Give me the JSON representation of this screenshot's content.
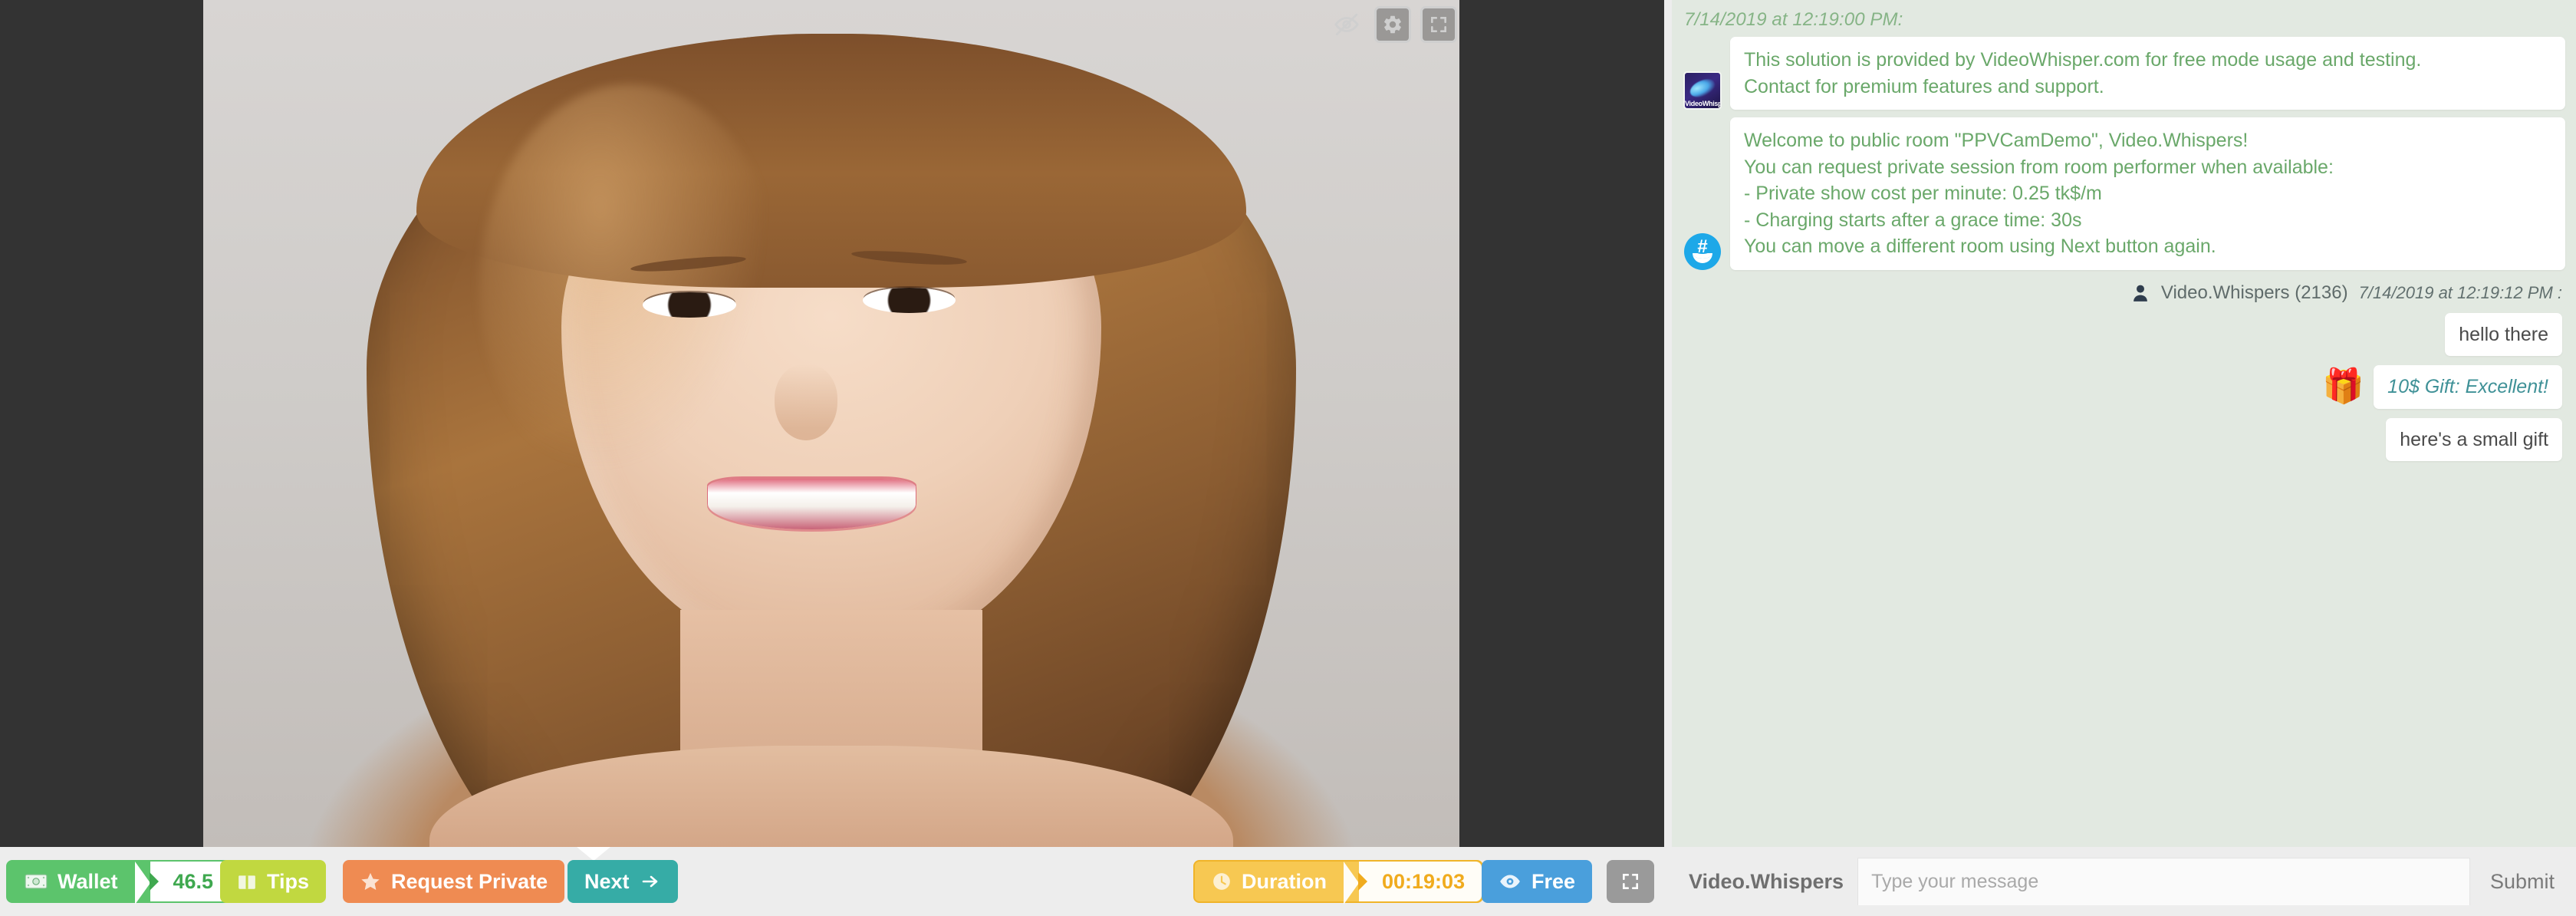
{
  "video": {
    "controls": [
      {
        "name": "hide-video-icon",
        "label": "eye-slash-icon",
        "boxed": false
      },
      {
        "name": "settings-icon",
        "label": "gear-icon",
        "boxed": true
      },
      {
        "name": "fullscreen-icon",
        "label": "expand-icon",
        "boxed": true
      }
    ]
  },
  "toolbar": {
    "wallet": {
      "label": "Wallet",
      "value": "46.5",
      "icon": "money-icon",
      "color": "#5cc46c"
    },
    "tips": {
      "label": "Tips",
      "icon": "gift-box-icon",
      "color": "#c1d840"
    },
    "request_private": {
      "label": "Request Private",
      "icon": "star-icon",
      "color": "#ef8b52"
    },
    "next": {
      "label": "Next",
      "icon": "arrow-right-icon",
      "color": "#36aca6"
    },
    "duration": {
      "label": "Duration",
      "value": "00:19:03",
      "icon": "clock-icon",
      "color": "#f7c852"
    },
    "mode": {
      "label": "Free",
      "icon": "eye-icon",
      "color": "#4a9fdc"
    },
    "fullscreen": {
      "label": "",
      "icon": "expand-icon",
      "color": "#9a9a9a"
    }
  },
  "chat": {
    "timestamp": "7/14/2019 at 12:19:00 PM:",
    "system_messages": [
      {
        "avatar": "videowhisper-logo",
        "avatar_text": "VideoWhisper",
        "lines": [
          "This solution is provided by VideoWhisper.com for free mode usage and testing.",
          "Contact for premium features and support."
        ]
      },
      {
        "avatar": "hash-smile-icon",
        "avatar_text": "#",
        "lines": [
          "Welcome to public room \"PPVCamDemo\", Video.Whispers!",
          "You can request private session from room performer when available:",
          "- Private show cost per minute: 0.25 tk$/m",
          "- Charging starts after a grace time: 30s",
          "You can move a different room using Next button again."
        ]
      }
    ],
    "user_header": {
      "icon": "person-icon",
      "username": "Video.Whispers (2136)",
      "timestamp": "7/14/2019 at 12:19:12 PM :"
    },
    "user_messages": [
      {
        "text": "hello there",
        "type": "text",
        "icon": ""
      },
      {
        "text": "10$ Gift: Excellent!",
        "type": "gift",
        "icon": "gift-emoji"
      },
      {
        "text": "here's a small gift",
        "type": "text",
        "icon": ""
      }
    ]
  },
  "chat_input": {
    "username": "Video.Whispers",
    "placeholder": "Type your message",
    "value": "",
    "submit_label": "Submit"
  }
}
